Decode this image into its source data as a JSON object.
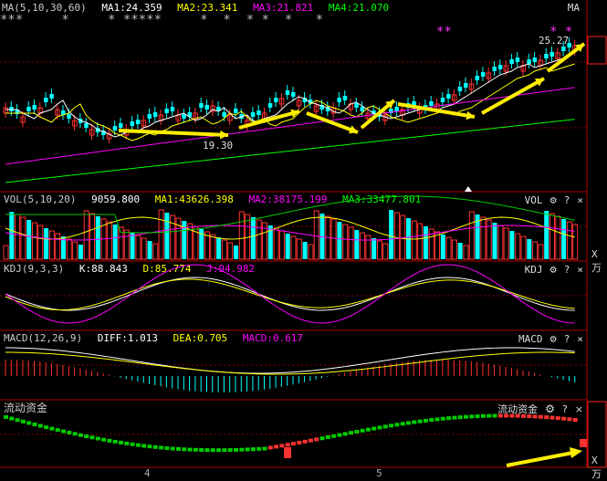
{
  "price_panel": {
    "header": {
      "title": "MA(5,10,30,60)",
      "ma1": "MA1:24.359",
      "ma2": "MA2:23.341",
      "ma3": "MA3:21.821",
      "ma4": "MA4:21.070",
      "corner": "MA"
    },
    "star_row1": "***     *     * *****     *  *  * *  *   *",
    "star_row2": "**",
    "stars_right": "* *",
    "high_label": "25.27",
    "low_label": "19.30",
    "colors": {
      "ma1": "#ffffff",
      "ma2": "#ffff00",
      "ma3": "#ff00ff",
      "ma4": "#00ff00"
    }
  },
  "vol_panel": {
    "title": "VOL(5,10,20)",
    "value": "9059.800",
    "ma1": "MA1:43626.398",
    "ma2": "MA2:38175.199",
    "ma3": "MA3:33477.801",
    "corner": "VOL",
    "unit": "X万"
  },
  "kdj_panel": {
    "title": "KDJ(9,3,3)",
    "k": "K:88.843",
    "d": "D:85.774",
    "j": "J:94.982",
    "corner": "KDJ"
  },
  "macd_panel": {
    "title": "MACD(12,26,9)",
    "diff": "DIFF:1.013",
    "dea": "DEA:0.705",
    "macd": "MACD:0.617",
    "corner": "MACD"
  },
  "flow_panel": {
    "title": "流动资金",
    "corner": "流动资金",
    "unit": "X万"
  },
  "axis": {
    "month_a": "4",
    "month_b": "5"
  },
  "tools": {
    "gear_icon": "gear-icon",
    "help": "?",
    "close": "×"
  }
}
